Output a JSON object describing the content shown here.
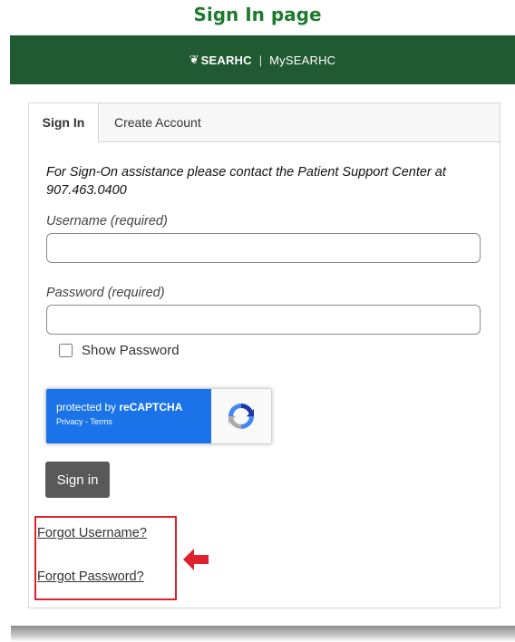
{
  "page_title": "Sign In page",
  "header": {
    "brand_name": "SEARHC",
    "separator": "|",
    "app_name": "MySEARHC",
    "bg_color": "#205a31"
  },
  "tabs": [
    {
      "label": "Sign In",
      "active": true
    },
    {
      "label": "Create Account",
      "active": false
    }
  ],
  "notice": "For Sign-On assistance please contact the Patient Support Center at 907.463.0400",
  "username": {
    "label": "Username (required)",
    "value": ""
  },
  "password": {
    "label": "Password (required)",
    "value": ""
  },
  "show_password": {
    "label": "Show Password",
    "checked": false
  },
  "recaptcha": {
    "protected_by": "protected by ",
    "brand": "reCAPTCHA",
    "links": "Privacy - Terms",
    "icon": "recaptcha-logo-icon"
  },
  "signin_button": "Sign in",
  "forgot_username": "Forgot Username?",
  "forgot_password": "Forgot Password?",
  "annotation": {
    "icon": "red-arrow-left-icon",
    "color": "#e0202a"
  }
}
